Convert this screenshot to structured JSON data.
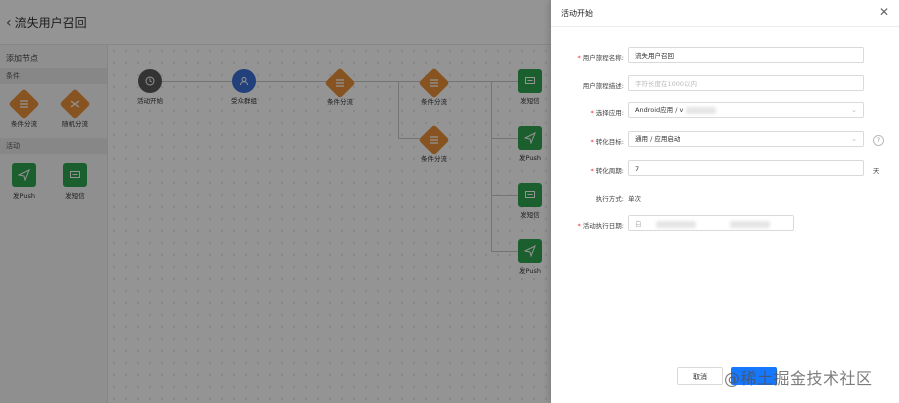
{
  "header": {
    "back_title": "流失用户召回"
  },
  "palette": {
    "title": "添加节点",
    "conditions_section": "条件",
    "conditions": [
      {
        "label": "条件分流",
        "icon": "list-icon"
      },
      {
        "label": "随机分流",
        "icon": "shuffle-icon"
      }
    ],
    "activities_section": "活动",
    "activities": [
      {
        "label": "发Push",
        "icon": "send-icon"
      },
      {
        "label": "发短信",
        "icon": "sms-icon"
      }
    ]
  },
  "flow": {
    "nodes": [
      {
        "label": "活动开始",
        "icon": "clock-icon"
      },
      {
        "label": "受众群组",
        "icon": "user-icon"
      },
      {
        "label": "条件分流",
        "icon": "list-icon"
      },
      {
        "label": "条件分流",
        "icon": "list-icon"
      },
      {
        "label": "条件分流",
        "icon": "list-icon"
      },
      {
        "label": "发短信",
        "icon": "sms-icon"
      },
      {
        "label": "发Push",
        "icon": "send-icon"
      },
      {
        "label": "发短信",
        "icon": "sms-icon"
      },
      {
        "label": "发Push",
        "icon": "send-icon"
      }
    ]
  },
  "drawer": {
    "title": "活动开始",
    "fields": {
      "name": {
        "label": "用户旅程名称:",
        "value": "流失用户召回"
      },
      "desc": {
        "label": "用户旅程描述:",
        "placeholder": "字符长度在1000以内"
      },
      "app": {
        "label": "选择应用:",
        "value": "Android应用 / v"
      },
      "goal": {
        "label": "转化目标:",
        "value": "通用 / 应用启动"
      },
      "period": {
        "label": "转化周期:",
        "value": "7",
        "unit": "天"
      },
      "mode": {
        "label": "执行方式:",
        "value": "单次"
      },
      "date": {
        "label": "活动执行日期:",
        "value": "白"
      }
    },
    "cancel_label": "取消"
  },
  "watermark": {
    "text": "@稀土掘金技术社区"
  },
  "colors": {
    "condition": "#e8923a",
    "activity": "#2ea44f",
    "audience": "#3b6fd6",
    "start": "#595959",
    "primary": "#1677ff"
  }
}
